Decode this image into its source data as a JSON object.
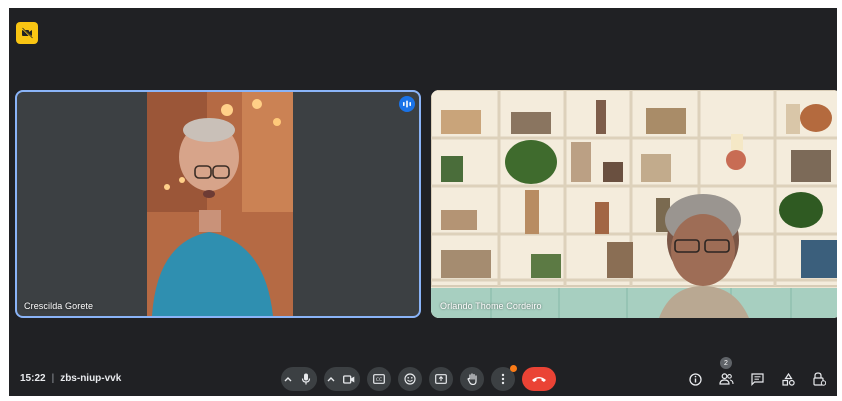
{
  "participants": [
    {
      "name": "Crescilda Gorete",
      "speaking": true
    },
    {
      "name": "Orlando Thome Cordeiro",
      "speaking": false
    }
  ],
  "meeting": {
    "time": "15:22",
    "separator": "|",
    "code": "zbs-niup-vvk"
  },
  "people_count": "2",
  "icons": {
    "corner": "camera-off-icon",
    "speaking": "audio-wave-icon",
    "mic": "mic-icon",
    "camera": "camera-icon",
    "captions": "captions-icon",
    "emoji": "emoji-icon",
    "present": "present-icon",
    "hand": "raise-hand-icon",
    "more": "more-vert-icon",
    "hangup": "hangup-icon",
    "info": "info-icon",
    "people": "people-icon",
    "chat": "chat-icon",
    "activities": "activities-icon",
    "host": "host-controls-icon"
  },
  "colors": {
    "background": "#202124",
    "active_border": "#8ab4f8",
    "hangup": "#ea4335",
    "badge": "#f9c513"
  }
}
